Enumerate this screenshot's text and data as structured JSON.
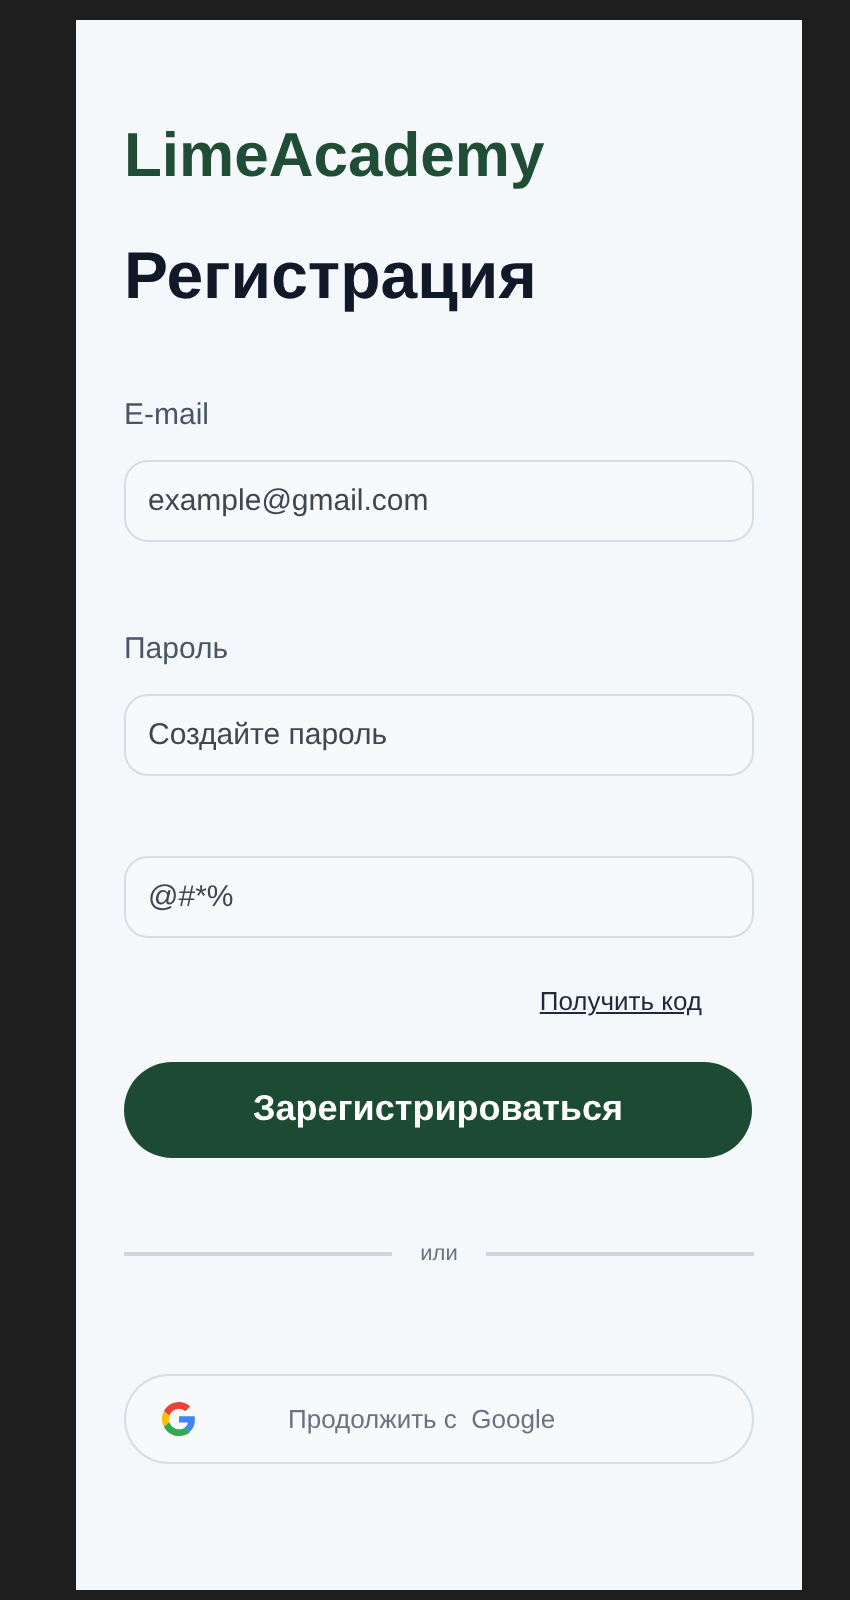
{
  "logo": "LimeAcademy",
  "title": "Регистрация",
  "fields": [
    {
      "label": "E-mail",
      "placeholder": "example@gmail.com"
    },
    {
      "label": "Пароль",
      "placeholder": "Создайте пароль"
    },
    {
      "placeholder": "@#*%"
    }
  ],
  "get_code_link": "Получить код",
  "submit_button": "Зарегистрироваться",
  "divider_text": "или",
  "google_button": "Продолжить с  Google"
}
